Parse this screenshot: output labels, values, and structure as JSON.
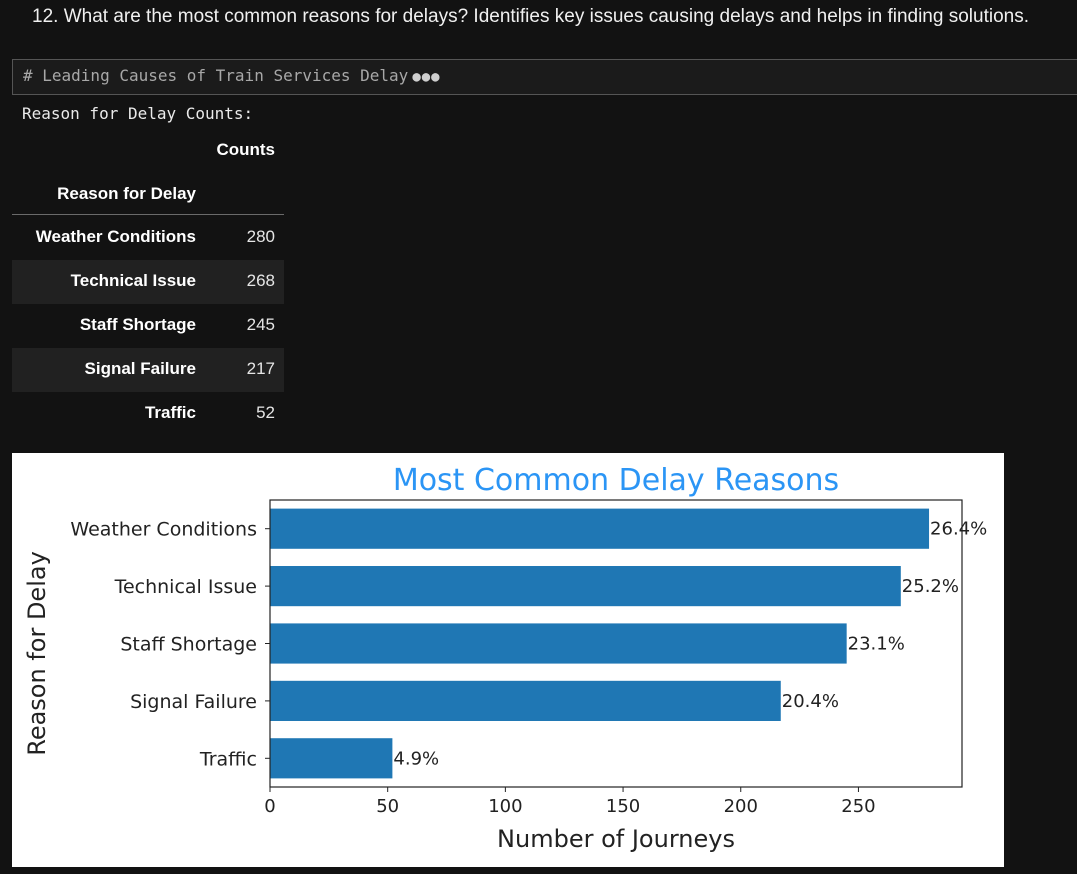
{
  "question": "12. What are the most common reasons for delays? Identifies key issues causing delays and helps in finding solutions.",
  "code_cell": {
    "comment": "# Leading Causes of Train Services Delay",
    "dots": "●●●"
  },
  "output_label": "Reason for Delay Counts:",
  "dataframe": {
    "column_header": "Counts",
    "index_header": "Reason for Delay",
    "rows": [
      {
        "label": "Weather Conditions",
        "value": "280"
      },
      {
        "label": "Technical Issue",
        "value": "268"
      },
      {
        "label": "Staff Shortage",
        "value": "245"
      },
      {
        "label": "Signal Failure",
        "value": "217"
      },
      {
        "label": "Traffic",
        "value": "52"
      }
    ]
  },
  "chart_data": {
    "type": "bar",
    "orientation": "horizontal",
    "title": "Most Common Delay Reasons",
    "xlabel": "Number of Journeys",
    "ylabel": "Reason for Delay",
    "categories": [
      "Weather Conditions",
      "Technical Issue",
      "Staff Shortage",
      "Signal Failure",
      "Traffic"
    ],
    "values": [
      280,
      268,
      245,
      217,
      52
    ],
    "data_labels": [
      "26.4%",
      "25.2%",
      "23.1%",
      "20.4%",
      "4.9%"
    ],
    "xticks": [
      0,
      50,
      100,
      150,
      200,
      250
    ],
    "xlim": [
      0,
      294
    ],
    "grid": false,
    "colors": {
      "bar": "#1f77b4",
      "title": "#2b95f5",
      "text": "#222222"
    }
  }
}
